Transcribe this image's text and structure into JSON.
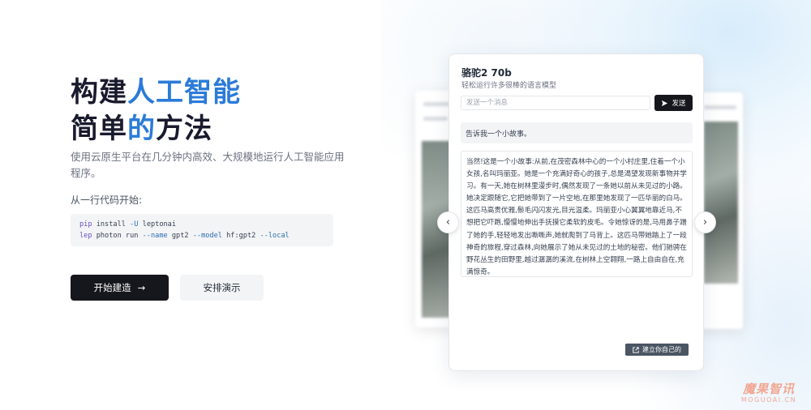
{
  "hero": {
    "title_line1_a": "构建",
    "title_line1_b": "人工智能",
    "title_line2_a": "简单",
    "title_line2_b": "的",
    "title_line2_c": "方法",
    "subtitle": "使用云原生平台在几分钟内高效、大规模地运行人工智能应用程序。",
    "code_label": "从一行代码开始:",
    "code": {
      "line1_cmd": "pip",
      "line1_rest": " install ",
      "line1_flag": "-U",
      "line1_pkg": " leptonai",
      "line2_cmd": "lep",
      "line2_a": " photon run ",
      "line2_flag1": "--name",
      "line2_b": " gpt2 ",
      "line2_flag2": "--model",
      "line2_c": " hf:gpt2 ",
      "line2_flag3": "--local"
    },
    "primary_button": "开始建造",
    "secondary_button": "安排演示"
  },
  "demo_card": {
    "title": "骆驼2 70b",
    "subtitle": "轻松运行许多很棒的语言模型",
    "input_placeholder": "发送一个消息",
    "send_label": "发送",
    "prompt": "告诉我一个小故事。",
    "story": "当然!这是一个小故事:从前,在茂密森林中心的一个小村庄里,住着一个小女孩,名叫玛丽亚。她是一个充满好奇心的孩子,总是渴望发现新事物并学习。有一天,她在树林里漫步时,偶然发现了一条她以前从未见过的小路。她决定跟随它,它把她带到了一片空地,在那里她发现了一匹华丽的白马。这匹马高贵优雅,鬃毛闪闪发光,目光温柔。玛丽亚小心翼翼地靠近马,不想把它吓跑,慢慢地伸出手抚摸它柔软的皮毛。令她惊讶的是,马用鼻子蹭了她的手,轻轻地发出嘶嘶声,她就爬到了马背上。这匹马带她踏上了一段神奇的旅程,穿过森林,向她展示了她从未见过的土地的秘密。他们驰骋在野花丛生的田野里,越过潺潺的溪流,在树林上空翱翔,一路上自由自在,充满惊奇。",
    "build_label": "建立你自己的"
  },
  "icons": {
    "arrow_right": "→",
    "send": "send-icon",
    "external": "external-link-icon",
    "prev": "‹",
    "next": "›"
  },
  "watermark": {
    "line1": "魔果智讯",
    "line2": "MOGUOAI.CN"
  },
  "colors": {
    "accent": "#2b7bd8",
    "dark_button": "#16161d"
  }
}
